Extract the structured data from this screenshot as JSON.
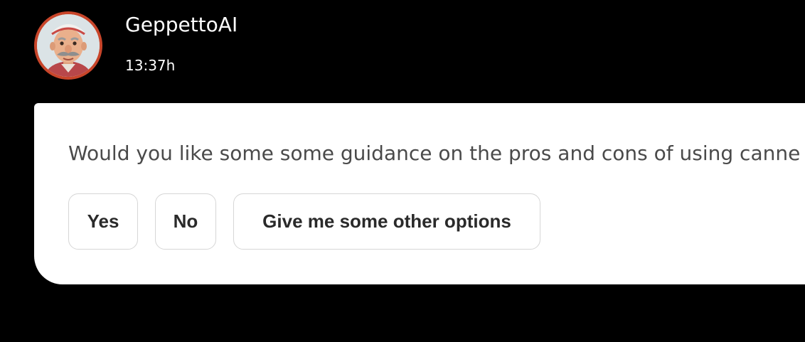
{
  "header": {
    "assistant_name": "GeppettoAI",
    "timestamp": "13:37h",
    "avatar_icon": "geppetto-avatar-icon",
    "avatar_ring_color": "#c8452a"
  },
  "card": {
    "message": "Would you like some some guidance on the pros and cons of using canne",
    "options": [
      {
        "label": "Yes"
      },
      {
        "label": "No"
      },
      {
        "label": "Give me some other options"
      }
    ]
  }
}
